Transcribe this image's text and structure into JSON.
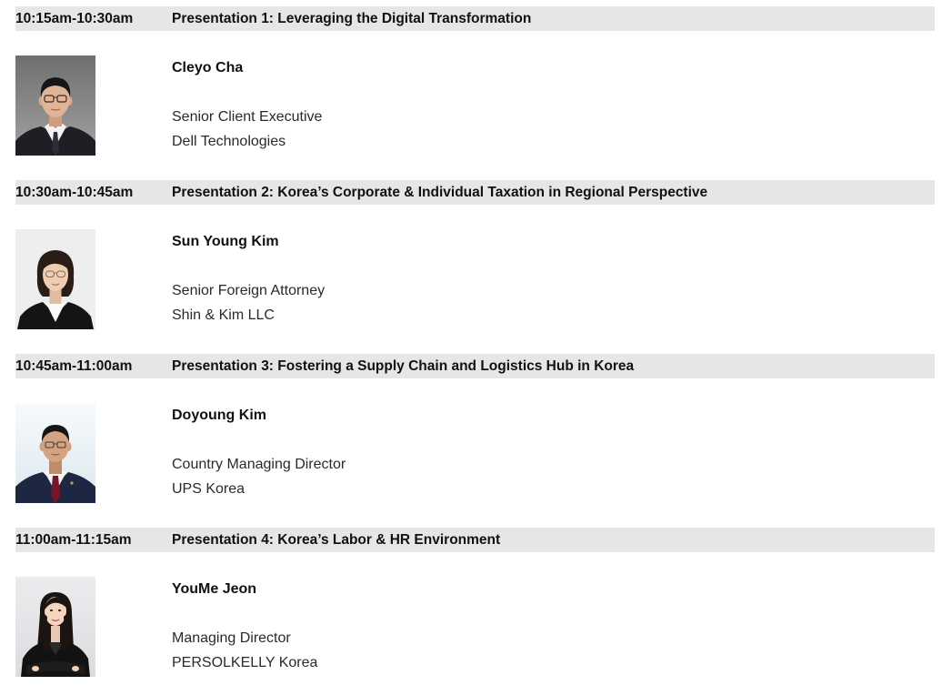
{
  "colors": {
    "header_bar": "#e6e6e6",
    "text": "#111111",
    "subtext": "#2a2a2a"
  },
  "sessions": [
    {
      "time": "10:15am-10:30am",
      "title": "Presentation 1: Leveraging the Digital Transformation",
      "speaker": {
        "name": "Cleyo Cha",
        "role": "Senior Client Executive",
        "organization": "Dell Technologies"
      }
    },
    {
      "time": "10:30am-10:45am",
      "title": "Presentation 2: Korea’s Corporate & Individual Taxation in Regional Perspective",
      "speaker": {
        "name": "Sun Young Kim",
        "role": "Senior Foreign Attorney",
        "organization": "Shin & Kim LLC"
      }
    },
    {
      "time": "10:45am-11:00am",
      "title": "Presentation 3: Fostering a Supply Chain and Logistics Hub in Korea",
      "speaker": {
        "name": "Doyoung Kim",
        "role": "Country Managing Director",
        "organization": "UPS Korea"
      }
    },
    {
      "time": "11:00am-11:15am",
      "title": "Presentation 4: Korea’s Labor & HR Environment",
      "speaker": {
        "name": "YouMe Jeon",
        "role": "Managing Director",
        "organization": "PERSOLKELLY Korea"
      }
    }
  ]
}
